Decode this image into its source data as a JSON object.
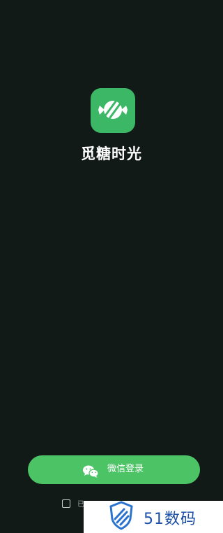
{
  "app": {
    "name": "觅糖时光",
    "icon": "candy-icon",
    "accent_color": "#3bb766"
  },
  "login": {
    "wechat_button_label": "微信登录",
    "wechat_icon": "wechat-icon",
    "button_color": "#4cc466"
  },
  "agreement": {
    "text": "已"
  },
  "watermark": {
    "text": "51数码",
    "icon": "shield-logo-icon"
  },
  "colors": {
    "background": "#121a18"
  }
}
